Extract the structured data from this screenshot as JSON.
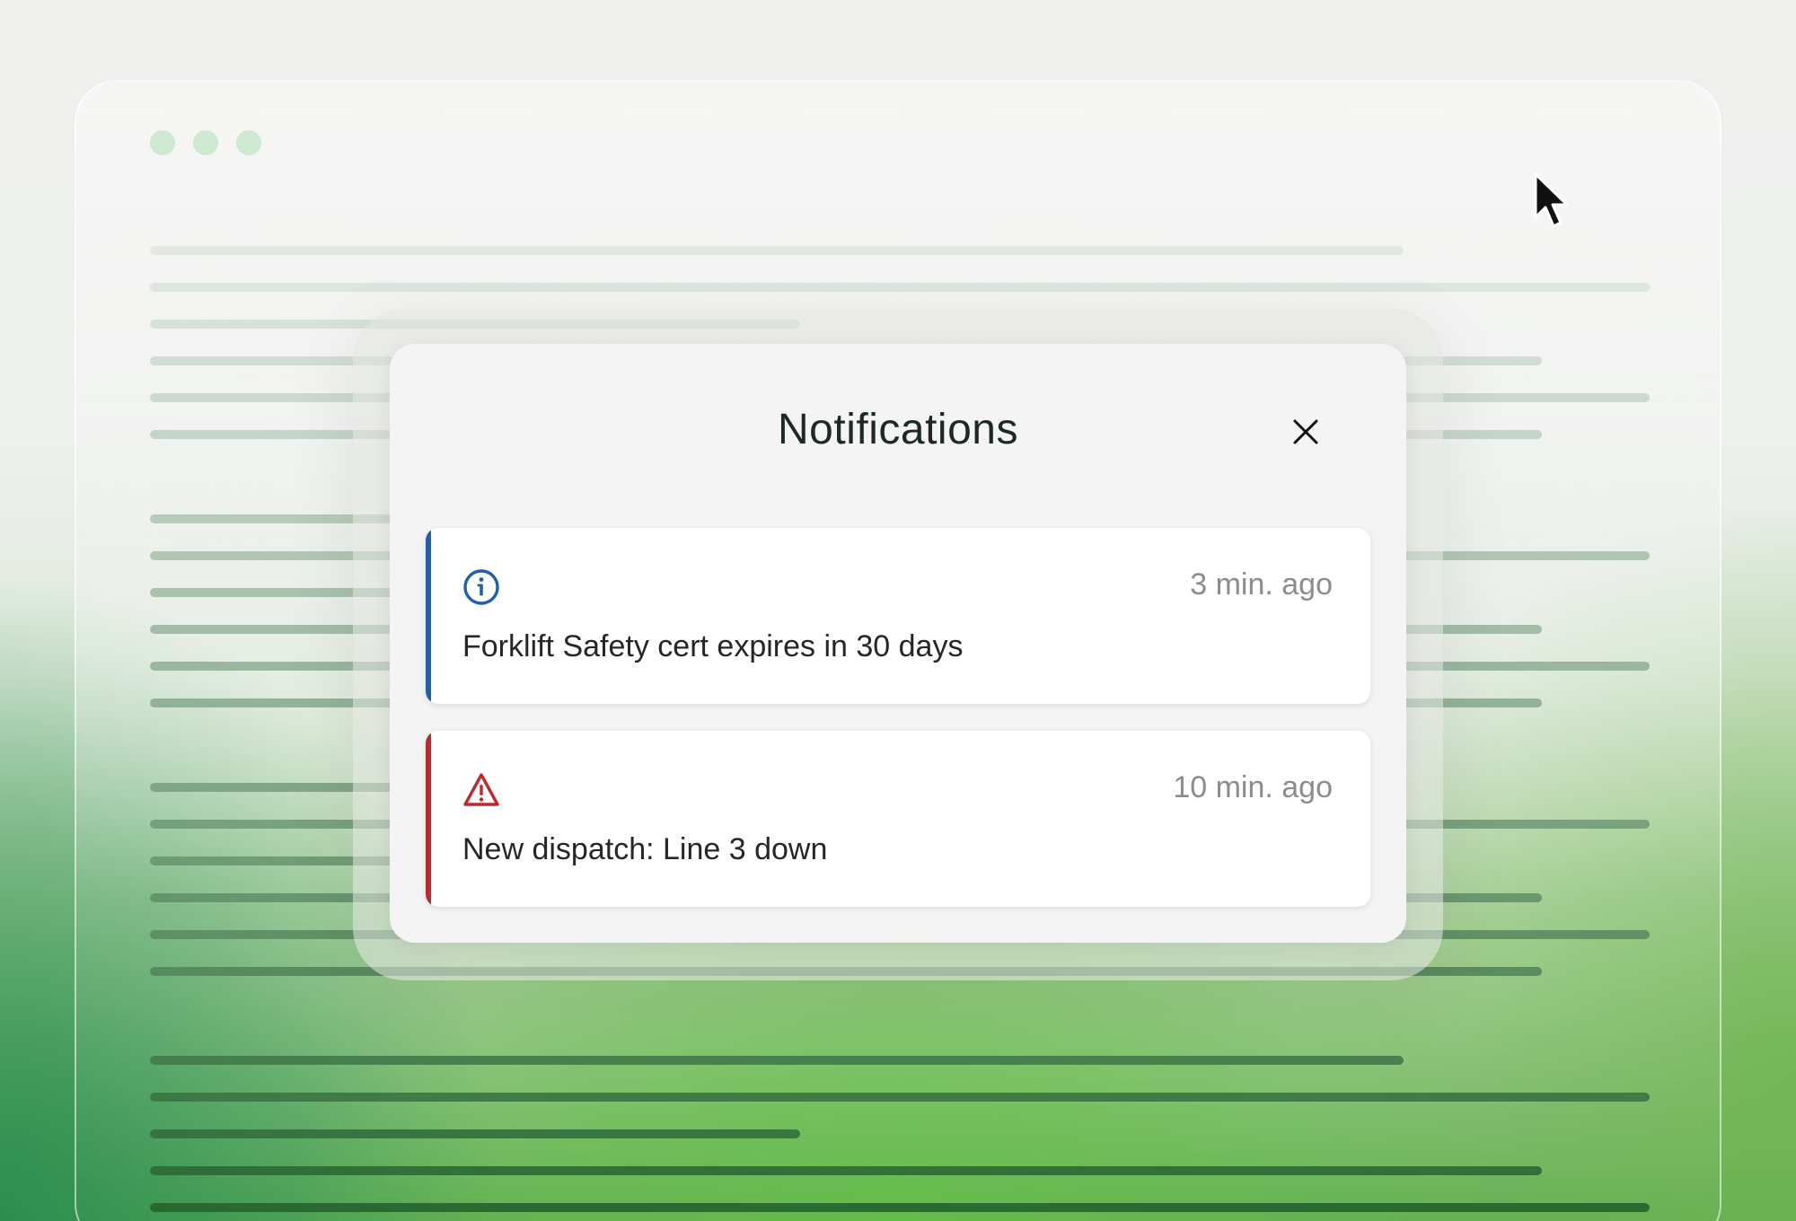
{
  "window": {
    "controls": [
      "close-dot",
      "minimize-dot",
      "maximize-dot"
    ]
  },
  "modal": {
    "title": "Notifications",
    "close_icon": "close-icon"
  },
  "notifications": [
    {
      "icon": "info-icon",
      "time": "3 min. ago",
      "message": "Forklift Safety cert expires in 30 days",
      "accent_color": "#1f5fae"
    },
    {
      "icon": "warning-icon",
      "time": "10 min. ago",
      "message": "New dispatch: Line 3 down",
      "accent_color": "#c0282b"
    }
  ],
  "colors": {
    "info": "#1f5fae",
    "warning": "#c0282b",
    "title": "#1c2b22",
    "timestamp": "#8c8c8c"
  }
}
